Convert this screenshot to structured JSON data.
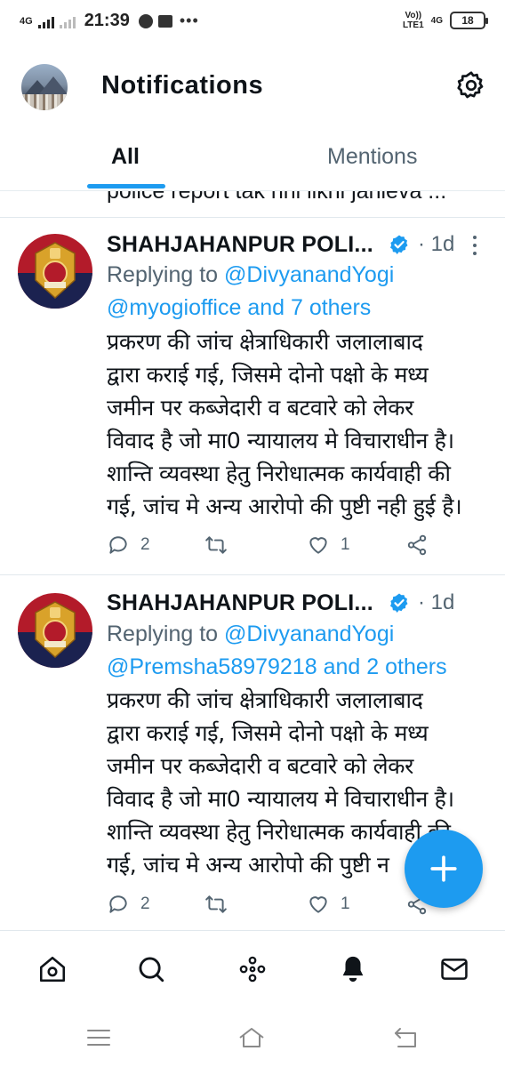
{
  "status_bar": {
    "network_left": "4G",
    "time": "21:39",
    "more": "•••",
    "volte_top": "Vo))",
    "volte_bottom": "LTE1",
    "network_right": "4G",
    "battery": "18"
  },
  "header": {
    "title": "Notifications"
  },
  "tabs": [
    {
      "label": "All",
      "active": true
    },
    {
      "label": "Mentions",
      "active": false
    }
  ],
  "previous_clip_text": "police report tak nhi likhi janieva ...",
  "tweets": [
    {
      "name": "SHAHJAHANPUR POLI...",
      "time": "1d",
      "replying_prefix": "Replying to ",
      "reply_mention_1": "@DivyanandYogi",
      "reply_mention_2": "@myogioffice and 7 others",
      "body_lines": [
        "प्रकरण की जांच क्षेत्राधिकारी जलालाबाद",
        "द्वारा कराई गई, जिसमे दोनो पक्षो के मध्य",
        "जमीन पर कब्जेदारी व बटवारे को लेकर",
        "विवाद है जो मा0 न्यायालय मे विचाराधीन है।",
        "शान्ति व्यवस्था हेतु निरोधात्मक कार्यवाही की",
        "गई, जांच मे अन्य आरोपो की पुष्टी नही हुई है।"
      ],
      "replies": "2",
      "retweets": "",
      "likes": "1"
    },
    {
      "name": "SHAHJAHANPUR POLI...",
      "time": "1d",
      "replying_prefix": "Replying to ",
      "reply_mention_1": "@DivyanandYogi",
      "reply_mention_2": "@Premsha58979218 and 2 others",
      "body_lines": [
        "प्रकरण की जांच क्षेत्राधिकारी जलालाबाद",
        "द्वारा कराई गई, जिसमे दोनो पक्षो के मध्य",
        "जमीन पर कब्जेदारी व बटवारे को लेकर",
        "विवाद है जो मा0 न्यायालय मे विचाराधीन है।",
        "शान्ति व्यवस्था हेतु निरोधात्मक कार्यवाही की",
        "गई, जांच मे अन्य आरोपो की पुष्टी न"
      ],
      "replies": "2",
      "retweets": "",
      "likes": "1"
    }
  ],
  "colors": {
    "accent": "#1d9bf0",
    "secondary_text": "#536471",
    "primary_text": "#0f1419"
  },
  "icons": {
    "settings": "gear-icon",
    "compose": "plus-icon",
    "nav": [
      "home-icon",
      "search-icon",
      "spaces-icon",
      "notifications-bell-icon",
      "messages-mail-icon"
    ],
    "system": [
      "recents-icon",
      "home-system-icon",
      "back-icon"
    ]
  }
}
